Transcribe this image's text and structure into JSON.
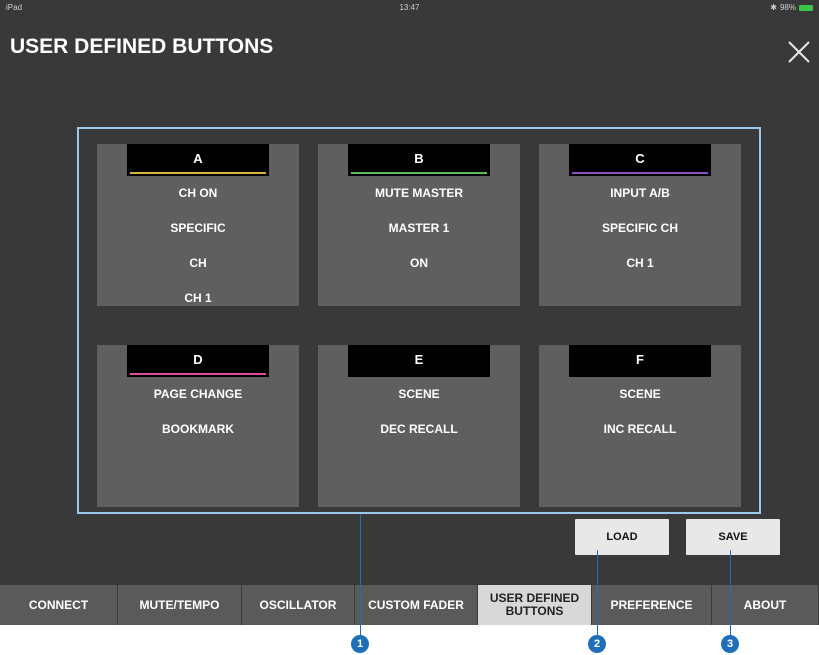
{
  "status_bar": {
    "device": "iPad",
    "time": "13:47",
    "battery": "98%",
    "battery_icon": "battery-icon"
  },
  "header": {
    "title": "USER DEFINED BUTTONS"
  },
  "buttons": [
    {
      "label": "A",
      "color": "#d8b23a",
      "lines": [
        "CH ON",
        "SPECIFIC",
        "CH",
        "CH 1"
      ]
    },
    {
      "label": "B",
      "color": "#5bbd5a",
      "lines": [
        "MUTE MASTER",
        "MASTER 1",
        "ON",
        ""
      ]
    },
    {
      "label": "C",
      "color": "#8a52c2",
      "lines": [
        "INPUT A/B",
        "SPECIFIC CH",
        "CH 1",
        ""
      ]
    },
    {
      "label": "D",
      "color": "#e04d9b",
      "lines": [
        "PAGE CHANGE",
        "BOOKMARK",
        "",
        ""
      ]
    },
    {
      "label": "E",
      "color": "#000000",
      "lines": [
        "SCENE",
        "DEC RECALL",
        "",
        ""
      ]
    },
    {
      "label": "F",
      "color": "#000000",
      "lines": [
        "SCENE",
        "INC RECALL",
        "",
        ""
      ]
    }
  ],
  "actions": {
    "load": "LOAD",
    "save": "SAVE"
  },
  "tabs": [
    {
      "label": "CONNECT"
    },
    {
      "label": "MUTE/TEMPO"
    },
    {
      "label": "OSCILLATOR"
    },
    {
      "label": "CUSTOM FADER"
    },
    {
      "label": "USER DEFINED BUTTONS",
      "active": true
    },
    {
      "label": "PREFERENCE"
    },
    {
      "label": "ABOUT"
    }
  ],
  "callouts": [
    "1",
    "2",
    "3"
  ],
  "colors": {
    "accent_blue": "#1f6fb8",
    "panel_border": "#9cc8ea",
    "background": "#393939"
  }
}
